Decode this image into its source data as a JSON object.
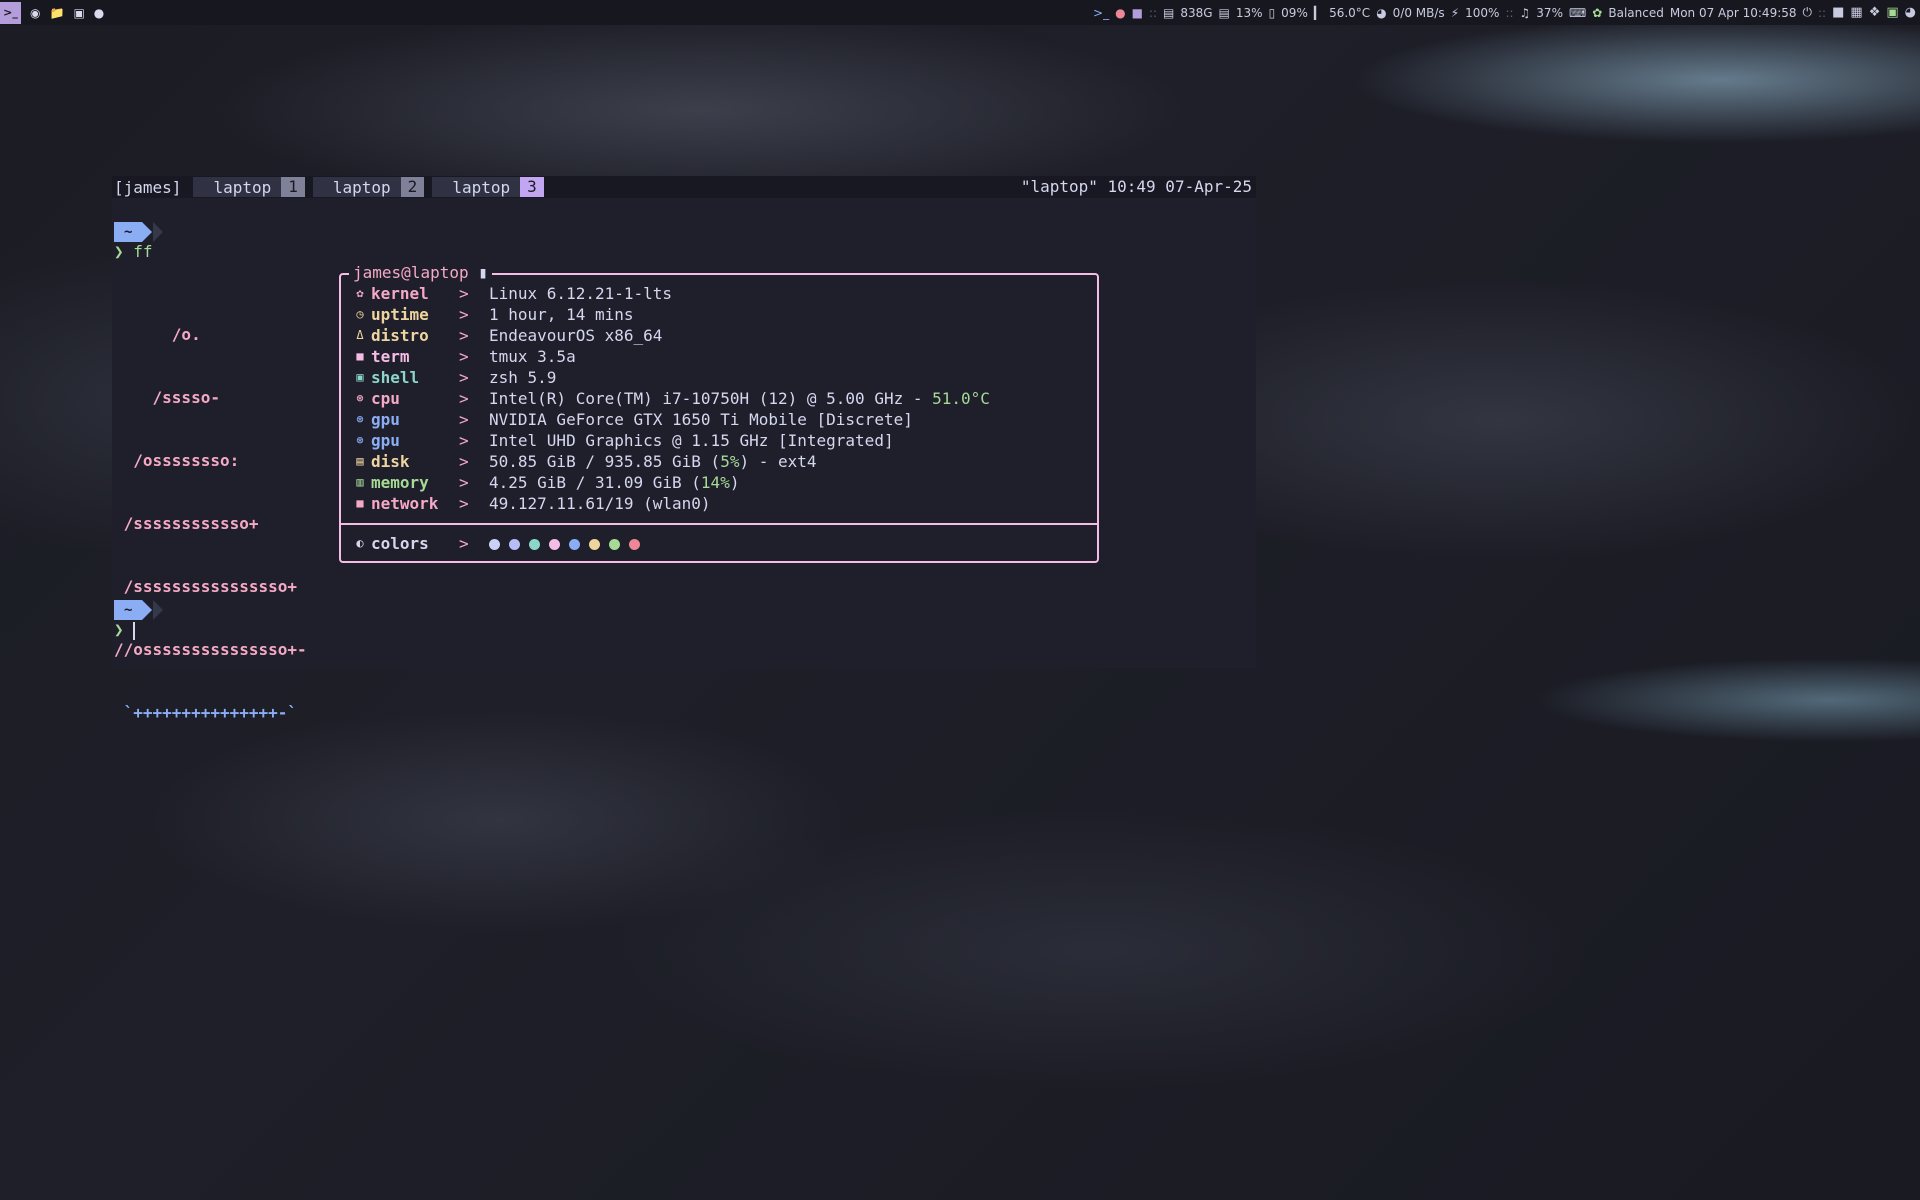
{
  "topbar": {
    "launcher_icon": "terminal-icon",
    "left_icons": [
      "firefox-icon",
      "folder-icon",
      "contacts-icon",
      "chat-icon"
    ],
    "right": {
      "disk": "838G",
      "cpu": "13%",
      "battery_pct": "09%",
      "temp": "56.0°C",
      "net": "0/0 MB/s",
      "charge": "100%",
      "volume": "37%",
      "power_profile": "Balanced",
      "datetime": "Mon 07 Apr 10:49:58"
    },
    "tray_icons": [
      "discord-icon",
      "docker-icon",
      "dropbox-icon",
      "lock-icon",
      "wifi-icon"
    ]
  },
  "tmux": {
    "session": "[james]",
    "windows": [
      {
        "name": "laptop",
        "index": "1",
        "active": false
      },
      {
        "name": "laptop",
        "index": "2",
        "active": false
      },
      {
        "name": "laptop",
        "index": "3",
        "active": true
      }
    ],
    "status_right": "\"laptop\" 10:49 07-Apr-25"
  },
  "prompt": {
    "dir": "~",
    "symbol": "❯",
    "command": "ff"
  },
  "logo_lines": [
    "      /o.",
    "    /sssso-",
    "  /ossssssso:",
    " /ssssssssssso+",
    " /ssssssssssssssso+",
    "//osssssssssssssso+-",
    " `+++++++++++++++-`"
  ],
  "fastfetch": {
    "user": "james",
    "host": "laptop",
    "separator": ">",
    "rows": [
      {
        "icon": "gear-icon",
        "key": "kernel",
        "value": "Linux 6.12.21-1-lts",
        "color": "#f5a9c4"
      },
      {
        "icon": "clock-icon",
        "key": "uptime",
        "value": "1 hour, 14 mins",
        "color": "#eed49f"
      },
      {
        "icon": "linux-icon",
        "key": "distro",
        "value": "EndeavourOS x86_64",
        "color": "#eed49f"
      },
      {
        "icon": "terminal-icon",
        "key": "term",
        "value": "tmux 3.5a",
        "color": "#f5bde6"
      },
      {
        "icon": "shell-icon",
        "key": "shell",
        "value": "zsh 5.9",
        "color": "#8bd5ca"
      },
      {
        "icon": "chip-icon",
        "key": "cpu",
        "value": "Intel(R) Core(TM) i7-10750H (12) @ 5.00 GHz - ",
        "extra": "51.0°C",
        "color": "#f5a9c4"
      },
      {
        "icon": "chip-icon",
        "key": "gpu",
        "value": "NVIDIA GeForce GTX 1650 Ti Mobile [Discrete]",
        "color": "#8aadf4"
      },
      {
        "icon": "chip-icon",
        "key": "gpu",
        "value": "Intel UHD Graphics @ 1.15 GHz [Integrated]",
        "color": "#8aadf4"
      },
      {
        "icon": "disk-icon",
        "key": "disk",
        "value": "50.85 GiB / 935.85 GiB (",
        "extra": "5%",
        "tail": ") - ext4",
        "color": "#eed49f"
      },
      {
        "icon": "memory-icon",
        "key": "memory",
        "value": "4.25 GiB / 31.09 GiB (",
        "extra": "14%",
        "tail": ")",
        "color": "#a6da95"
      },
      {
        "icon": "network-icon",
        "key": "network",
        "value": "49.127.11.61/19 (wlan0)",
        "color": "#f5a9c4"
      }
    ],
    "colors_label": "colors",
    "colors_icon": "palette-icon",
    "palette": [
      "#cad3f5",
      "#b7bdf8",
      "#8bd5ca",
      "#f5bde6",
      "#8aadf4",
      "#eed49f",
      "#a6da95",
      "#ed8796"
    ]
  }
}
